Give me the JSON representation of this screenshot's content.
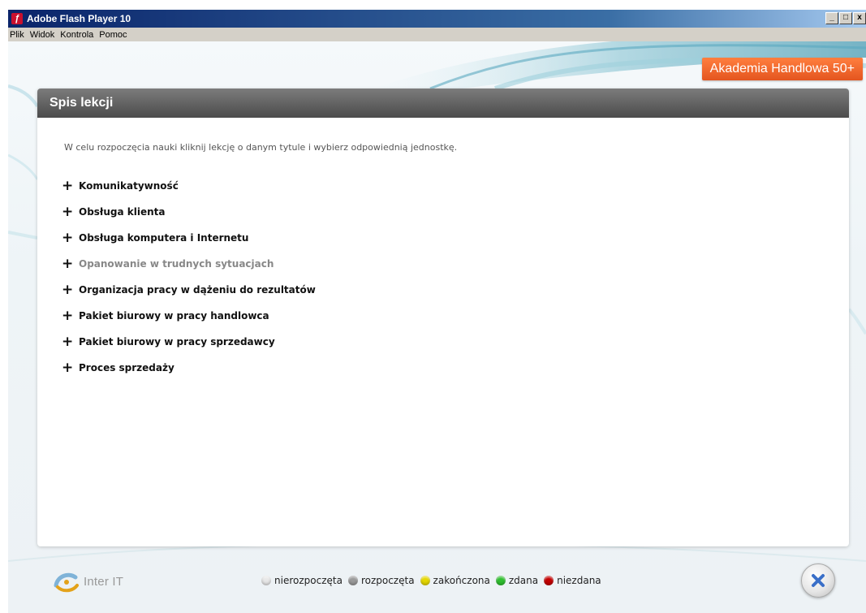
{
  "window": {
    "title": "Adobe Flash Player 10",
    "menu": [
      {
        "label": "Plik"
      },
      {
        "label": "Widok"
      },
      {
        "label": "Kontrola"
      },
      {
        "label": "Pomoc"
      }
    ],
    "buttons": {
      "minimize": "_",
      "maximize": "□",
      "close": "x"
    }
  },
  "brand": {
    "label": "Akademia Handlowa 50+"
  },
  "panel": {
    "title": "Spis lekcji",
    "instruction": "W celu rozpoczęcia nauki kliknij lekcję o danym tytule i wybierz odpowiednią jednostkę.",
    "lessons": [
      {
        "label": "Komunikatywność"
      },
      {
        "label": "Obsługa klienta"
      },
      {
        "label": "Obsługa komputera i Internetu"
      },
      {
        "label": "Opanowanie w trudnych sytuacjach"
      },
      {
        "label": "Organizacja pracy w dążeniu do rezultatów"
      },
      {
        "label": "Pakiet biurowy w pracy handlowca"
      },
      {
        "label": "Pakiet biurowy w pracy sprzedawcy"
      },
      {
        "label": "Proces sprzedaży"
      }
    ]
  },
  "footer": {
    "logo_text": "Inter IT",
    "legend": [
      {
        "label": "nierozpoczęta",
        "color": "#e8e8e8"
      },
      {
        "label": "rozpoczęta",
        "color": "#9a9a9a"
      },
      {
        "label": "zakończona",
        "color": "#e6d800"
      },
      {
        "label": "zdana",
        "color": "#2fbf2f"
      },
      {
        "label": "niezdana",
        "color": "#c40000"
      }
    ]
  },
  "colors": {
    "accent": "#e4551f",
    "header": "#5a5a5a",
    "close_icon": "#3a6fc8"
  }
}
